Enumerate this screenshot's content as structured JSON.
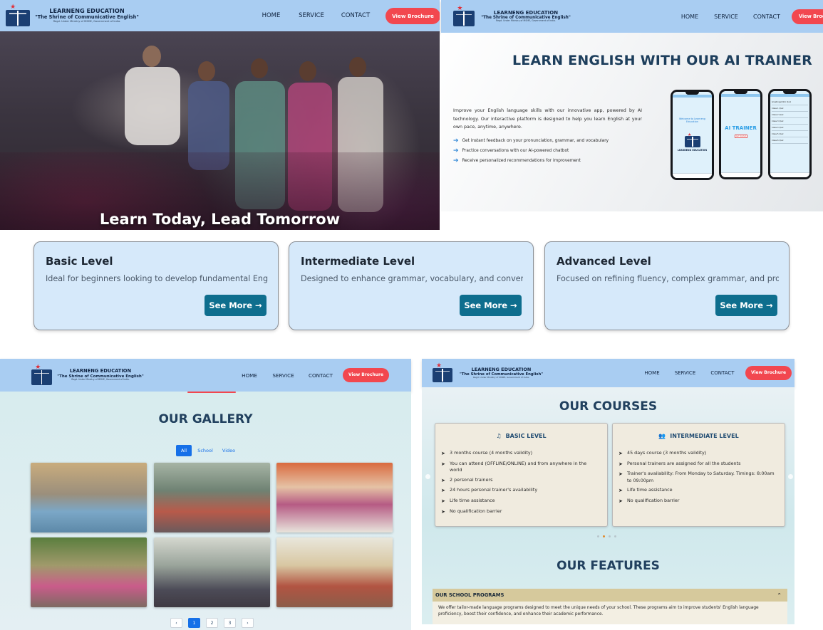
{
  "header": {
    "brand_title": "LEARNENG EDUCATION",
    "brand_subtitle": "\"The Shrine of Communicative English\"",
    "brand_reg": "Regd. Under Ministry of MSME, Government of India.",
    "nav": [
      "HOME",
      "SERVICE",
      "CONTACT"
    ],
    "cta": "View Brochure",
    "cta_partial": "View Brochu"
  },
  "hero": {
    "tagline": "Learn Today, Lead Tomorrow"
  },
  "ai_trainer": {
    "title": "LEARN ENGLISH WITH OUR AI TRAINER",
    "description": "Improve your English language skills with our innovative app, powered by AI technology. Our interactive platform is designed to help you learn English at your own pace, anytime, anywhere.",
    "features": [
      "Get instant feedback on your pronunciation, grammar, and vocabulary",
      "Practice conversations with our AI-powered chatbot",
      "Receive personalized recommendations for improvement"
    ],
    "phone_screen_text": "Welcome to Learneng Education",
    "phone_brand": "LEARNENG EDUCATION",
    "phone_ai_label": "AI TRAINER",
    "phone_ai_button": "Get Started",
    "phone_list": [
      "Greetings/Intro Quiz",
      "Class 1 Quiz",
      "Class 2 Quiz",
      "Class 3 Quiz",
      "Class 4 Quiz",
      "Class 5 Quiz",
      "Class 6 Quiz"
    ]
  },
  "levels": [
    {
      "title": "Basic Level",
      "desc": "Ideal for beginners looking to develop fundamental English communication skills.",
      "button": "See More →"
    },
    {
      "title": "Intermediate Level",
      "desc": "Designed to enhance grammar, vocabulary, and conversational fluency.",
      "button": "See More →"
    },
    {
      "title": "Advanced Level",
      "desc": "Focused on refining fluency, complex grammar, and professional communication.",
      "button": "See More →"
    }
  ],
  "gallery": {
    "title": "OUR GALLERY",
    "filters": [
      "All",
      "School",
      "Video"
    ],
    "pages": [
      "‹",
      "1",
      "2",
      "3",
      "›"
    ]
  },
  "courses": {
    "title": "OUR COURSES",
    "cards": [
      {
        "icon": "music-note-icon",
        "title": "BASIC LEVEL",
        "items": [
          "3 months course (4 months validity)",
          "You can attend (OFFLINE/ONLINE) and from anywhere in the world",
          "2 personal trainers",
          "24 hours personal trainer's availability",
          "Life time assistance",
          "No qualification barrier"
        ]
      },
      {
        "icon": "user-group-icon",
        "title": "INTERMEDIATE LEVEL",
        "items": [
          "45 days course (3 months validity)",
          "Personal trainers are assigned for all the students",
          "Trainer's availability: From Monday to Saturday. Timings: 8:00am to 09:00pm",
          "Life time assistance",
          "No qualification barrier"
        ]
      }
    ],
    "features_title": "OUR FEATURES",
    "program_title": "OUR SCHOOL PROGRAMS",
    "program_text": "We offer tailor-made language programs designed to meet the unique needs of your school. These programs aim to improve students' English language proficiency, boost their confidence, and enhance their academic performance."
  },
  "colors": {
    "header_bg": "#a9cdf2",
    "cta_red": "#f2474f",
    "see_more": "#0e6e8e",
    "card_bg": "#d6e9fa",
    "filter_active": "#1670e8"
  }
}
